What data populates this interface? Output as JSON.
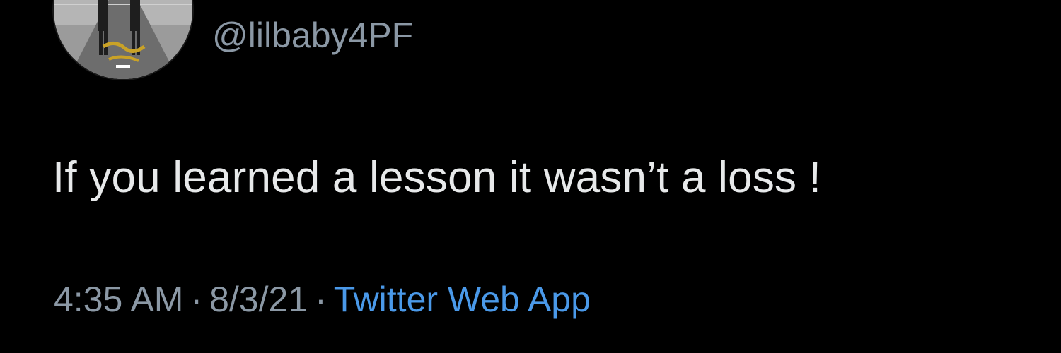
{
  "author": {
    "handle": "@lilbaby4PF",
    "avatar_icon": "album-cover-avatar"
  },
  "tweet": {
    "text": "If you learned a lesson it wasn’t a loss !"
  },
  "meta": {
    "time": "4:35 AM",
    "date": "8/3/21",
    "separator": "·",
    "source": "Twitter Web App"
  },
  "colors": {
    "background": "#000000",
    "text": "#e7e9ea",
    "secondary": "#8b98a5",
    "link": "#4a99e9"
  }
}
